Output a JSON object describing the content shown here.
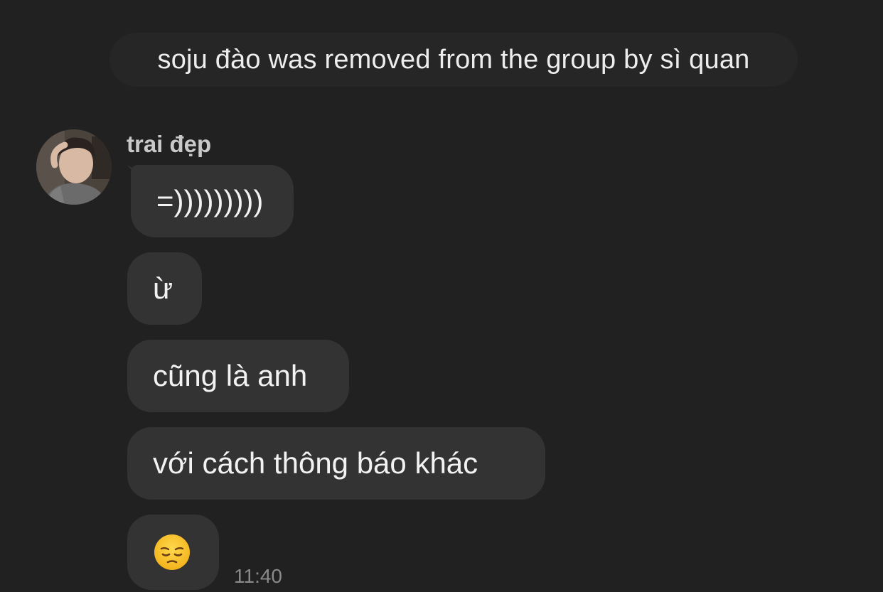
{
  "chat": {
    "system_message": "soju đào was removed from the group by sì quan",
    "sender": {
      "name": "trai đẹp",
      "avatar": "user-avatar-photo"
    },
    "messages": [
      {
        "text": "=)))))))))"
      },
      {
        "text": "ừ"
      },
      {
        "text": "cũng là anh"
      },
      {
        "text": "với cách thông báo khác"
      },
      {
        "emoji": "pensive-face-emoji"
      }
    ],
    "timestamp": "11:40"
  },
  "colors": {
    "background": "#212121",
    "bubble": "#333333",
    "system_pill": "#262626",
    "text": "#f2f2f2",
    "sender_name": "#c9c9c9",
    "timestamp": "#8a8a8a"
  }
}
